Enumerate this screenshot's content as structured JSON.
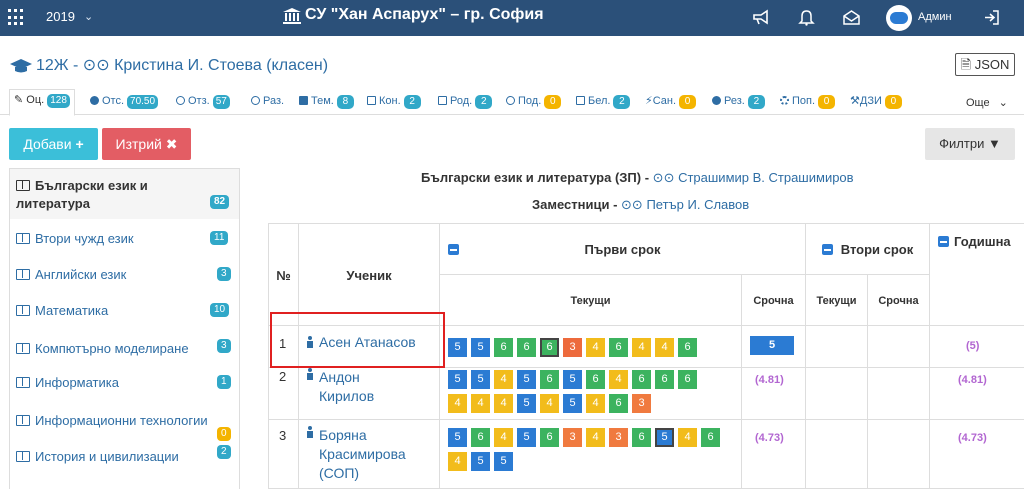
{
  "topbar": {
    "year": "2019",
    "school": "СУ \"Хан Аспарух\" – гр. София",
    "user": "Админ",
    "icons": [
      "apps-grid-icon",
      "chevron-down-icon",
      "school-building-icon",
      "megaphone-icon",
      "bell-icon",
      "envelope-icon",
      "avatar-icon",
      "logout-icon"
    ]
  },
  "header": {
    "title": "12Ж - ",
    "teacher": "Кристина И. Стоева (класен)",
    "json_label": "JSON"
  },
  "tabs": [
    {
      "label": "Оц.",
      "count": "128",
      "color": "b",
      "active": true
    },
    {
      "label": "Отс.",
      "count": "70.50",
      "color": "b"
    },
    {
      "label": "Отз.",
      "count": "57",
      "color": "b"
    },
    {
      "label": "Раз.",
      "count": "",
      "color": ""
    },
    {
      "label": "Тем.",
      "count": "8",
      "color": "b"
    },
    {
      "label": "Кон.",
      "count": "2",
      "color": "b"
    },
    {
      "label": "Род.",
      "count": "2",
      "color": "b"
    },
    {
      "label": "Под.",
      "count": "0",
      "color": "y"
    },
    {
      "label": "Бел.",
      "count": "2",
      "color": "b"
    },
    {
      "label": "Сан.",
      "count": "0",
      "color": "y"
    },
    {
      "label": "Рез.",
      "count": "2",
      "color": "b"
    },
    {
      "label": "Поп.",
      "count": "0",
      "color": "y"
    },
    {
      "label": "ДЗИ",
      "count": "0",
      "color": "y"
    }
  ],
  "more_label": "Още",
  "buttons": {
    "add": "Добави",
    "delete": "Изтрий",
    "filters": "Филтри"
  },
  "sidebar": [
    {
      "label": "Български език и литература",
      "count": "82"
    },
    {
      "label": "Втори чужд език",
      "count": "11"
    },
    {
      "label": "Английски език",
      "count": "3"
    },
    {
      "label": "Математика",
      "count": "10"
    },
    {
      "label": "Компютърно моделиране",
      "count": "3"
    },
    {
      "label": "Информатика",
      "count": "1"
    },
    {
      "label": "Информационни технологии",
      "count": "0"
    },
    {
      "label": "История и цивилизации",
      "count": "2"
    }
  ],
  "subject": {
    "name": "Български език и литература (ЗП) - ",
    "teacher": "Страшимир В. Страшимиров",
    "subs_label": "Заместници - ",
    "sub_teacher": "Петър И. Славов"
  },
  "table": {
    "col_num": "№",
    "col_student": "Ученик",
    "term1": "Първи срок",
    "term2": "Втори срок",
    "annual": "Годишна",
    "current": "Текущи",
    "term_grade": "Срочна",
    "current2": "Текущи",
    "term_grade2": "Срочна",
    "rows": [
      {
        "num": "1",
        "name": "Асен Атанасов",
        "grades": [
          "5",
          "5",
          "6",
          "6",
          "6",
          "3",
          "4",
          "6",
          "4",
          "4",
          "6"
        ],
        "term": "5",
        "annual": "(5)"
      },
      {
        "num": "2",
        "name": "Андон Кирилов",
        "grades": [
          "5",
          "5",
          "4",
          "5",
          "6",
          "5",
          "6",
          "4",
          "6",
          "6",
          "6",
          "4",
          "4",
          "4",
          "5",
          "4",
          "5",
          "4",
          "6",
          "3"
        ],
        "term": "(4.81)",
        "annual": "(4.81)"
      },
      {
        "num": "3",
        "name": "Боряна Красимирова (СОП)",
        "grades": [
          "5",
          "6",
          "4",
          "5",
          "6",
          "3",
          "4",
          "3",
          "6",
          "5",
          "4",
          "6",
          "4",
          "5",
          "5"
        ],
        "term": "(4.73)",
        "annual": "(4.73)"
      }
    ]
  }
}
